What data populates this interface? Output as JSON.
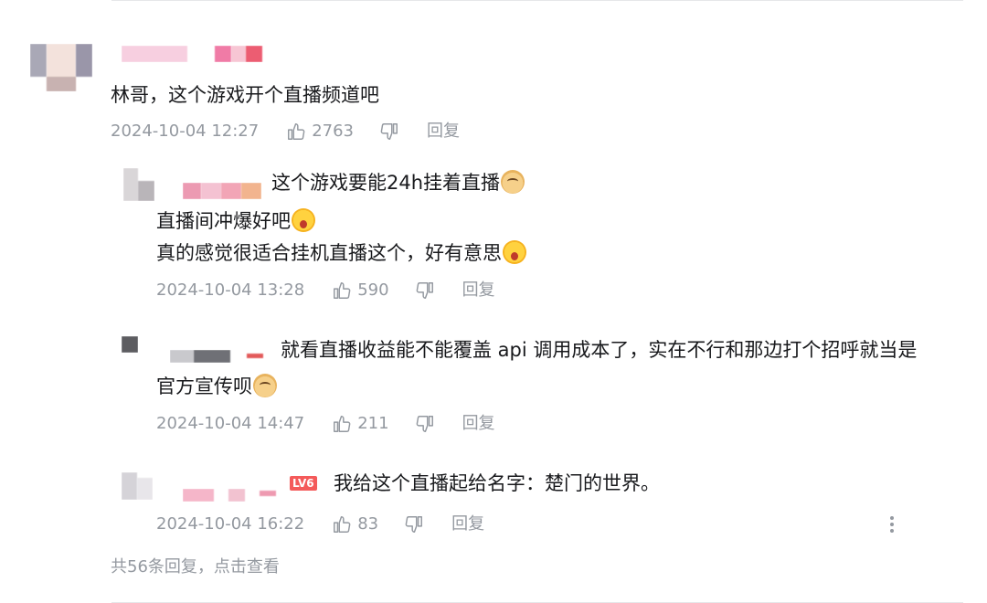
{
  "comment": {
    "text": "林哥，这个游戏开个直播频道吧",
    "timestamp": "2024-10-04 12:27",
    "likes": "2763",
    "reply_label": "回复"
  },
  "replies": [
    {
      "lines": [
        "这个游戏要能24h挂着直播",
        "直播间冲爆好吧",
        "真的感觉很适合挂机直播这个，好有意思"
      ],
      "timestamp": "2024-10-04 13:28",
      "likes": "590",
      "reply_label": "回复"
    },
    {
      "lines": [
        "就看直播收益能不能覆盖 api 调用成本了，实在不行和那边打个招呼就当是",
        "官方宣传呗"
      ],
      "timestamp": "2024-10-04 14:47",
      "likes": "211",
      "reply_label": "回复"
    },
    {
      "level_badge": "LV6",
      "lines": [
        "我给这个直播起给名字：楚门的世界。"
      ],
      "timestamp": "2024-10-04 16:22",
      "likes": "83",
      "reply_label": "回复"
    }
  ],
  "footer": "共56条回复，点击查看",
  "icons": {
    "like": "thumb-up-icon",
    "dislike": "thumb-down-icon",
    "more": "more-vertical-icon"
  },
  "colors": {
    "meta": "#9499a0",
    "text": "#18191c",
    "divider": "#e6e7e9"
  }
}
